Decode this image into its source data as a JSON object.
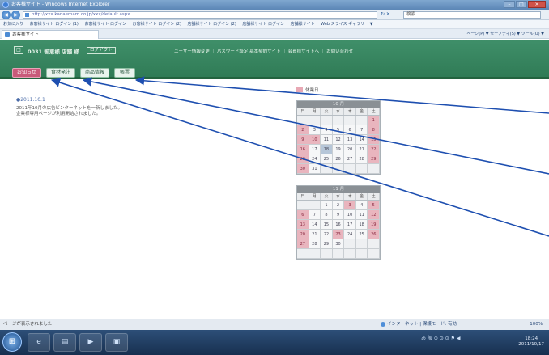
{
  "browser": {
    "title": "お客様サイト - Windows Internet Explorer",
    "url": "http://xxx.kanaemam.co.jp/xxx/default.aspx",
    "search_placeholder": "検索",
    "favorites_label": "お気に入り",
    "favorites": [
      "お客様サイト ログイン (1)",
      "お客様サイト ログイン",
      "お客様サイト ログイン (2)",
      "店舗様サイト ログイン (2)",
      "店舗様サイト ログイン",
      "店舗様サイト",
      "Web スライス ギャラリー ▼"
    ],
    "tab_label": "お客様サイト",
    "commands": "ページ(P) ▼  セーフティ(S) ▼  ツール(O) ▼"
  },
  "site": {
    "logo": "□",
    "title": "0031 御恵様 店舗 様",
    "logout_label": "ログアウト",
    "top_links": "ユーザー情報変更 ｜ パスワード設定     基本契約サイト ｜ 会員様サイトへ ｜ お問い合わせ",
    "menu": [
      {
        "label": "お知らせ",
        "active": true
      },
      {
        "label": "食材発注",
        "active": false
      },
      {
        "label": "商品情報",
        "active": false
      },
      {
        "label": "帳票",
        "active": false
      }
    ]
  },
  "news": {
    "date": "●2011.10.1",
    "body": "2011年10月の広告ビンターネットを一新しました。\n企業様専用ページが利用開始されました。"
  },
  "calendar": {
    "legend": "休業日",
    "weekdays": [
      "日",
      "月",
      "火",
      "水",
      "木",
      "金",
      "土"
    ],
    "months": [
      {
        "title": "10 月",
        "weeks": [
          [
            "",
            "",
            "",
            "",
            "",
            "",
            "1"
          ],
          [
            "2",
            "3",
            "4",
            "5",
            "6",
            "7",
            "8"
          ],
          [
            "9",
            "10",
            "11",
            "12",
            "13",
            "14",
            "15"
          ],
          [
            "16",
            "17",
            "18",
            "19",
            "20",
            "21",
            "22"
          ],
          [
            "23",
            "24",
            "25",
            "26",
            "27",
            "28",
            "29"
          ],
          [
            "30",
            "31",
            "",
            "",
            "",
            "",
            ""
          ]
        ]
      },
      {
        "title": "11 月",
        "weeks": [
          [
            "",
            "",
            "1",
            "2",
            "3",
            "4",
            "5"
          ],
          [
            "6",
            "7",
            "8",
            "9",
            "10",
            "11",
            "12"
          ],
          [
            "13",
            "14",
            "15",
            "16",
            "17",
            "18",
            "19"
          ],
          [
            "20",
            "21",
            "22",
            "23",
            "24",
            "25",
            "26"
          ],
          [
            "27",
            "28",
            "29",
            "30",
            "",
            "",
            ""
          ],
          [
            "",
            "",
            "",
            "",
            "",
            "",
            ""
          ]
        ]
      }
    ]
  },
  "status": {
    "left": "ページが表示されました",
    "mid": "インターネット | 保護モード: 有効",
    "zoom": "100%"
  },
  "taskbar": {
    "tray": "あ 般 ⊙ ⊙ ⊙ ⚑ ◀",
    "time": "18:24",
    "date": "2011/10/17"
  },
  "colors": {
    "header_green": "#3f8f69",
    "active_menu": "#c85a7a",
    "holiday": "#e9b5be",
    "calendar_head": "#8a9095",
    "arrow": "#1e4fb0"
  }
}
